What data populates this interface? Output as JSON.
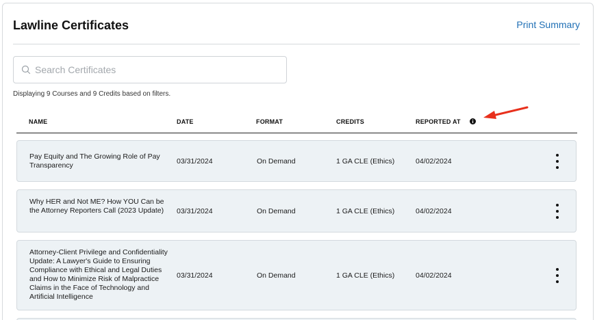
{
  "header": {
    "title": "Lawline Certificates",
    "print_label": "Print Summary"
  },
  "search": {
    "placeholder": "Search Certificates",
    "value": ""
  },
  "summary": "Displaying 9 Courses and 9 Credits based on filters.",
  "table": {
    "columns": {
      "name": "NAME",
      "date": "DATE",
      "format": "FORMAT",
      "credits": "CREDITS",
      "reported": "REPORTED AT"
    },
    "rows": [
      {
        "name": "Pay Equity and The Growing Role of Pay Transparency",
        "date": "03/31/2024",
        "format": "On Demand",
        "credits": "1 GA CLE (Ethics)",
        "reported": "04/02/2024"
      },
      {
        "name": "Why HER and Not ME? How YOU Can be the Attorney Reporters Call (2023 Update)",
        "date": "03/31/2024",
        "format": "On Demand",
        "credits": "1 GA CLE (Ethics)",
        "reported": "04/02/2024"
      },
      {
        "name": "Attorney-Client Privilege and Confidentiality Update: A Lawyer's Guide to Ensuring Compliance with Ethical and Legal Duties and How to Minimize Risk of Malpractice Claims in the Face of Technology and Artificial Intelligence",
        "date": "03/31/2024",
        "format": "On Demand",
        "credits": "1 GA CLE (Ethics)",
        "reported": "04/02/2024"
      }
    ]
  },
  "icons": {
    "search": "search-icon",
    "info": "info-icon",
    "row_menu": "kebab-menu-icon",
    "annotation": "red-arrow-icon"
  },
  "colors": {
    "link": "#1f6fb5",
    "row_bg": "#edf2f5",
    "annotation_arrow": "#e8301c"
  }
}
